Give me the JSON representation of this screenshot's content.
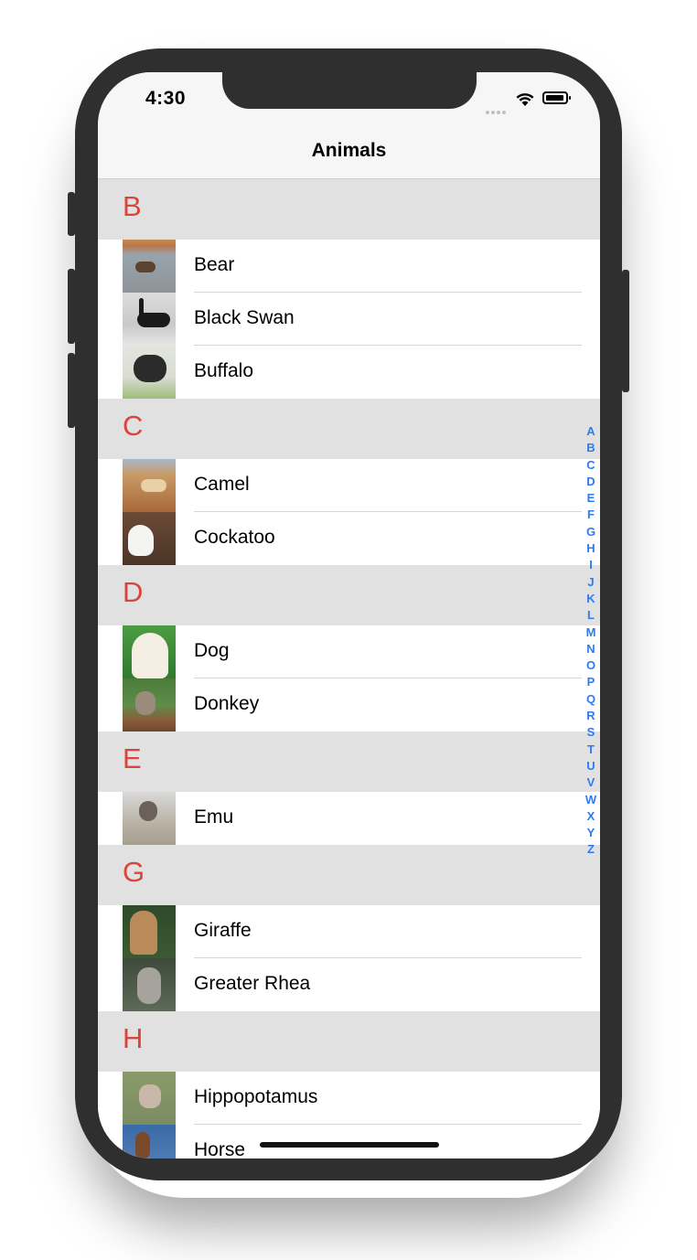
{
  "status_bar": {
    "time": "4:30"
  },
  "nav": {
    "title": "Animals"
  },
  "sections": [
    {
      "letter": "B",
      "rows": [
        "Bear",
        "Black Swan",
        "Buffalo"
      ]
    },
    {
      "letter": "C",
      "rows": [
        "Camel",
        "Cockatoo"
      ]
    },
    {
      "letter": "D",
      "rows": [
        "Dog",
        "Donkey"
      ]
    },
    {
      "letter": "E",
      "rows": [
        "Emu"
      ]
    },
    {
      "letter": "G",
      "rows": [
        "Giraffe",
        "Greater Rhea"
      ]
    },
    {
      "letter": "H",
      "rows": [
        "Hippopotamus",
        "Horse"
      ]
    }
  ],
  "index_letters": [
    "A",
    "B",
    "C",
    "D",
    "E",
    "F",
    "G",
    "H",
    "I",
    "J",
    "K",
    "L",
    "M",
    "N",
    "O",
    "P",
    "Q",
    "R",
    "S",
    "T",
    "U",
    "V",
    "W",
    "X",
    "Y",
    "Z"
  ],
  "colors": {
    "section_letter": "#d9453c",
    "index": "#2e7bf0",
    "section_bg": "#e1e1e1"
  }
}
